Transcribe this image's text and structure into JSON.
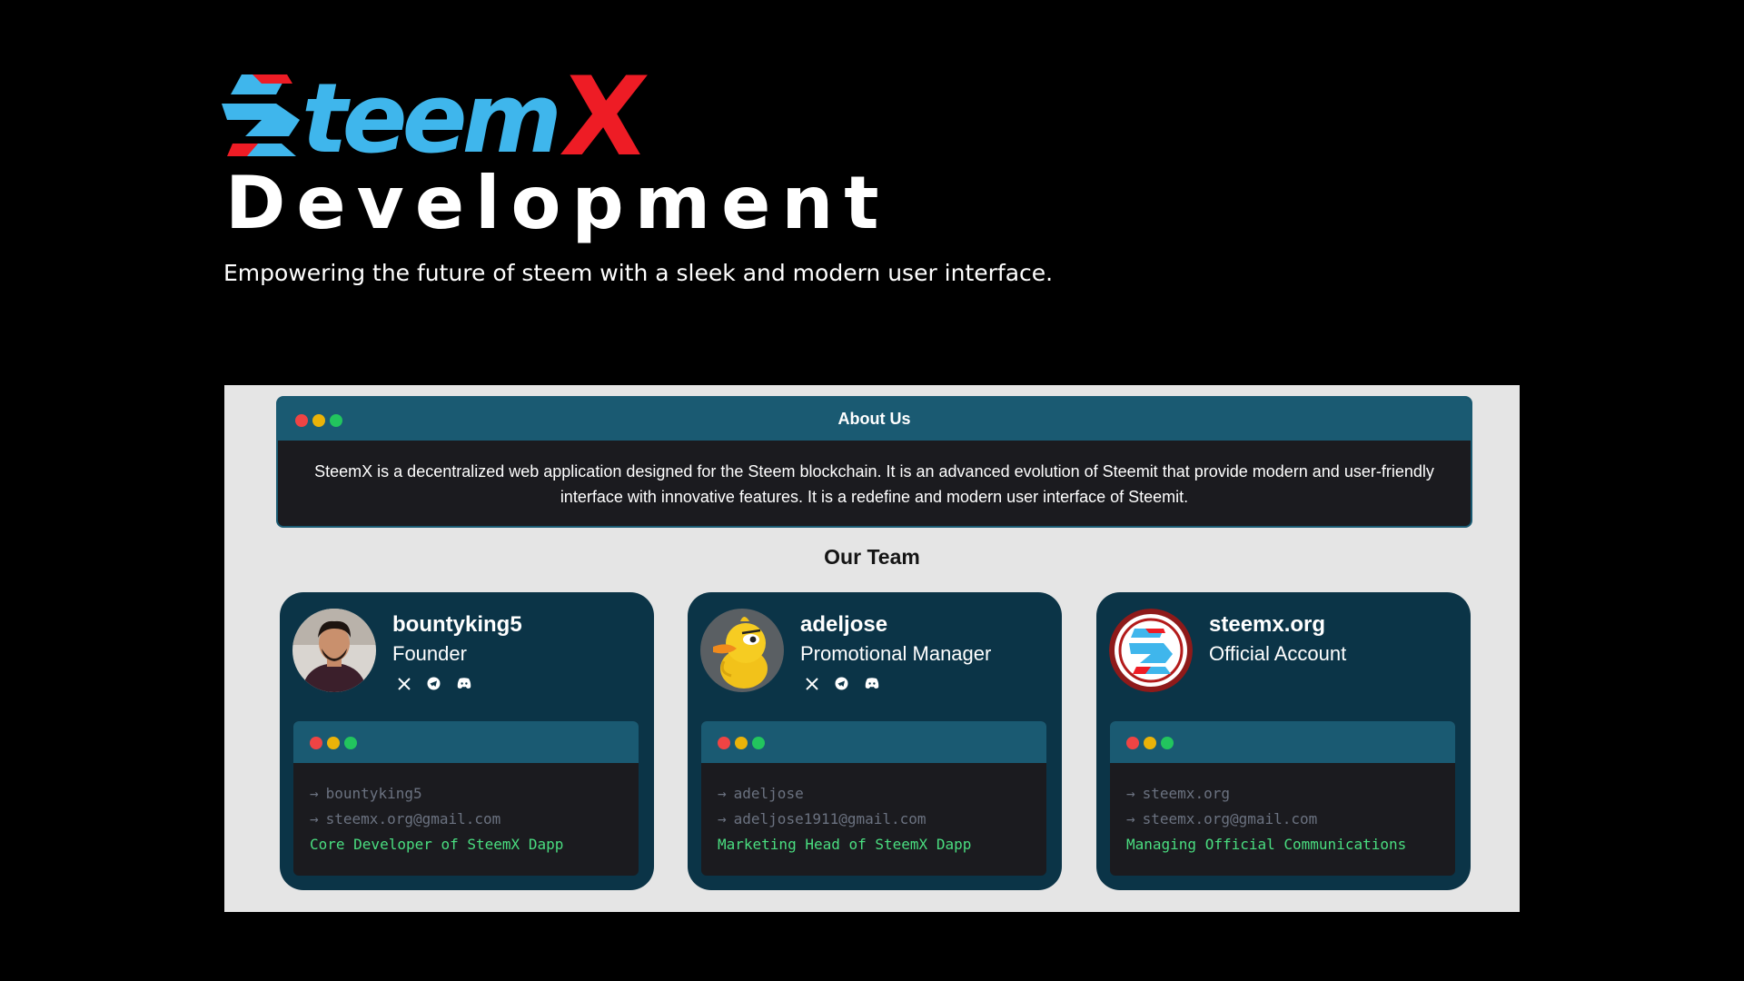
{
  "brand": {
    "logo_text": "teem",
    "logo_letter": "X"
  },
  "hero": {
    "title": "Development",
    "subtitle": "Empowering the future of steem with a sleek and modern user interface."
  },
  "about": {
    "title": "About Us",
    "text": "SteemX is a decentralized web application designed for the Steem blockchain. It is an advanced evolution of Steemit that provide modern and user-friendly interface with innovative features. It is a redefine and modern user interface of Steemit."
  },
  "team": {
    "title": "Our Team",
    "members": [
      {
        "name": "bountyking5",
        "role": "Founder",
        "username": "bountyking5",
        "email": "steemx.org@gmail.com",
        "description": "Core Developer of SteemX Dapp",
        "arrow": "→",
        "socials": [
          "x-icon",
          "telegram-icon",
          "discord-icon"
        ]
      },
      {
        "name": "adeljose",
        "role": "Promotional Manager",
        "username": "adeljose",
        "email": "adeljose1911@gmail.com",
        "description": "Marketing Head of SteemX Dapp",
        "arrow": "→",
        "socials": [
          "x-icon",
          "telegram-icon",
          "discord-icon"
        ]
      },
      {
        "name": "steemx.org",
        "role": "Official Account",
        "username": "steemx.org",
        "email": "steemx.org@gmail.com",
        "description": "Managing Official Communications",
        "arrow": "→",
        "socials": []
      }
    ]
  },
  "colors": {
    "background": "#000000",
    "panel": "#e5e5e5",
    "card": "#0b3447",
    "bar": "#1a5a72",
    "terminal": "#1b1b1f",
    "accent_blue": "#3fb6ec",
    "accent_red": "#ee1c25",
    "dot_red": "#ef4444",
    "dot_yellow": "#eab308",
    "dot_green": "#22c55e",
    "desc_green": "#4ade80"
  }
}
